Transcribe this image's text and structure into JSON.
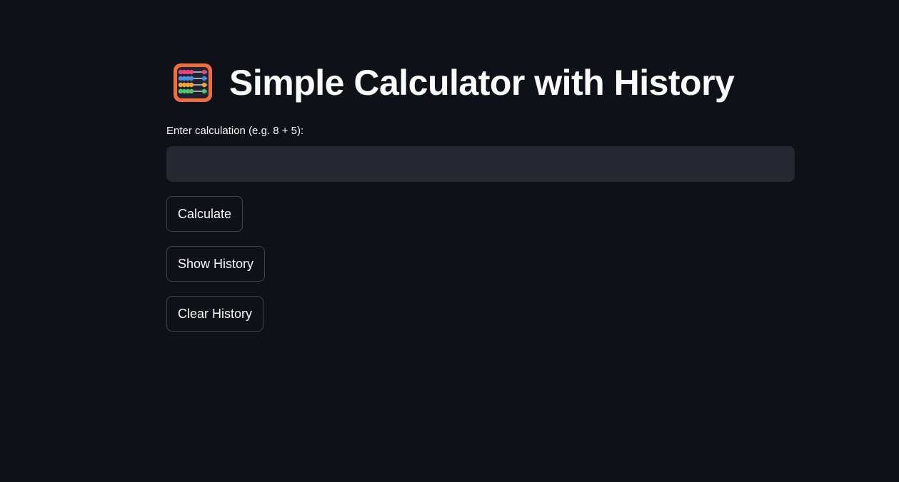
{
  "header": {
    "icon": "abacus-icon",
    "title": "Simple Calculator with History"
  },
  "form": {
    "input_label": "Enter calculation (e.g. 8 + 5):",
    "input_value": "",
    "input_placeholder": ""
  },
  "buttons": {
    "calculate": "Calculate",
    "show_history": "Show History",
    "clear_history": "Clear History"
  },
  "colors": {
    "background": "#0e1117",
    "input_background": "#262730",
    "text": "#fafafa"
  }
}
